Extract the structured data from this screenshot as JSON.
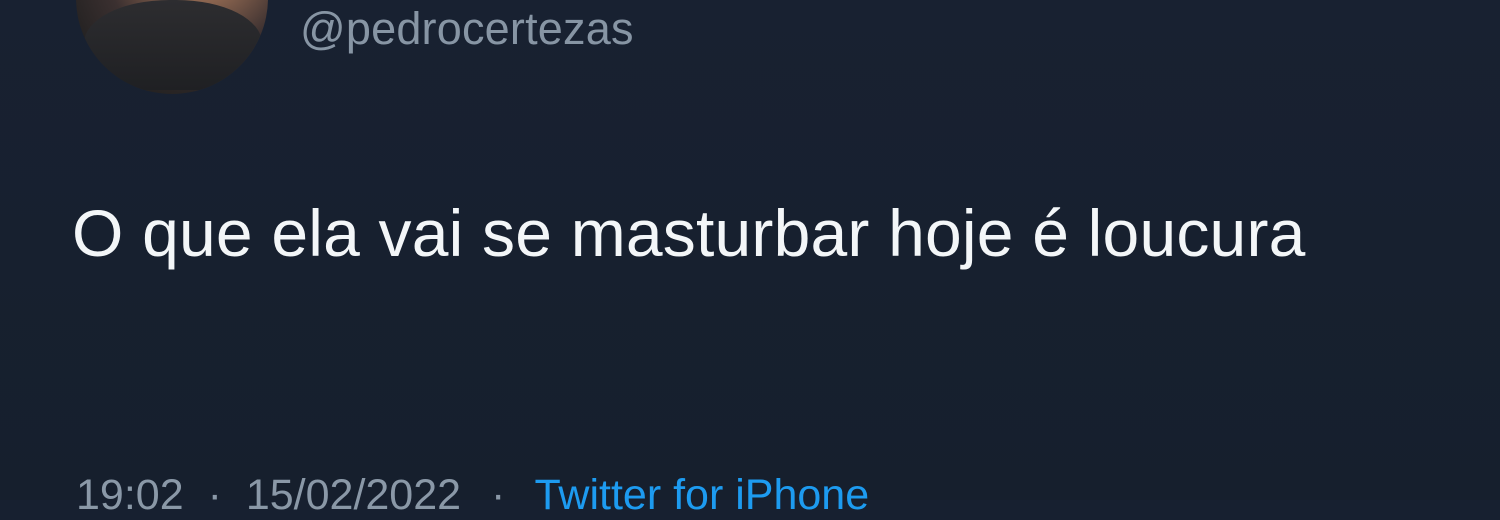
{
  "tweet": {
    "handle": "@pedrocertezas",
    "text": "O que ela vai se masturbar hoje é loucura",
    "meta": {
      "time": "19:02",
      "date": "15/02/2022",
      "separator": "·",
      "source": "Twitter for iPhone"
    },
    "avatar": {
      "overlay_icon": "plus-icon"
    },
    "colors": {
      "background": "#172030",
      "primary_text": "#F3F6F8",
      "secondary_text": "#8795A4",
      "link": "#1D9BF0"
    }
  }
}
